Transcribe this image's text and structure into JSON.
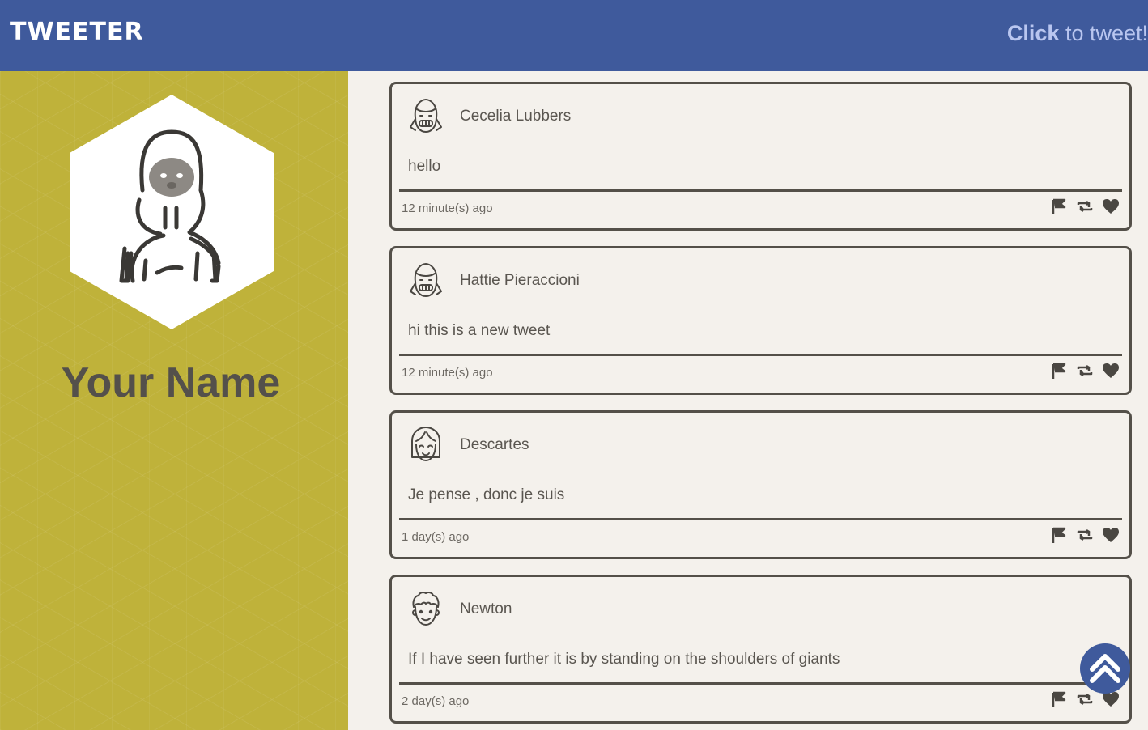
{
  "nav": {
    "brand": "TWEETER",
    "compose_emphasis": "Click",
    "compose_rest": " to tweet!"
  },
  "profile": {
    "name": "Your Name",
    "avatar_icon": "girl-portrait-icon"
  },
  "tweets": [
    {
      "author": "Cecelia Lubbers",
      "avatar_icon": "pigtail-girl-avatar-icon",
      "text": "hello",
      "time": "12 minute(s) ago"
    },
    {
      "author": "Hattie Pieraccioni",
      "avatar_icon": "pigtail-girl-avatar-icon",
      "text": "hi this is a new tweet",
      "time": "12 minute(s) ago"
    },
    {
      "author": "Descartes",
      "avatar_icon": "bob-hair-avatar-icon",
      "text": "Je pense , donc je suis",
      "time": "1 day(s) ago"
    },
    {
      "author": "Newton",
      "avatar_icon": "curly-hair-avatar-icon",
      "text": "If I have seen further it is by standing on the shoulders of giants",
      "time": "2 day(s) ago"
    }
  ],
  "actions": [
    "flag-icon",
    "retweet-icon",
    "heart-icon"
  ],
  "colors": {
    "nav": "#3f5a9c",
    "sidebar": "#bfb23a",
    "border": "#545049",
    "background": "#f4f1ec"
  }
}
